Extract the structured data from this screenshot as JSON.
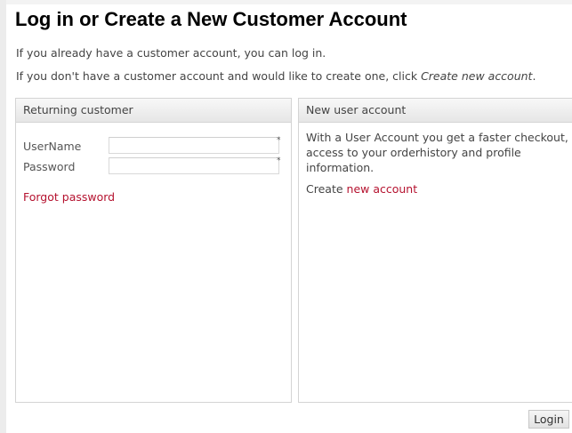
{
  "page": {
    "title": "Log in or Create a New Customer Account",
    "intro_line1": "If you already have a customer account, you can log in.",
    "intro_line2_prefix": "If you don't have a customer account and would like to create one, click ",
    "intro_line2_link": "Create new account",
    "intro_line2_suffix": "."
  },
  "returning_customer": {
    "heading": "Returning customer",
    "username_label": "UserName",
    "username_value": "",
    "password_label": "Password",
    "password_value": "",
    "required_marker": "*",
    "forgot_link": "Forgot password"
  },
  "new_user": {
    "heading": "New user account",
    "description": "With a User Account you get a faster checkout, access to your orderhistory and profile information.",
    "create_prefix": "Create ",
    "create_link": "new account"
  },
  "actions": {
    "login_label": "Login"
  },
  "colors": {
    "link": "#b5122f",
    "panel_border": "#d4d4d4"
  }
}
